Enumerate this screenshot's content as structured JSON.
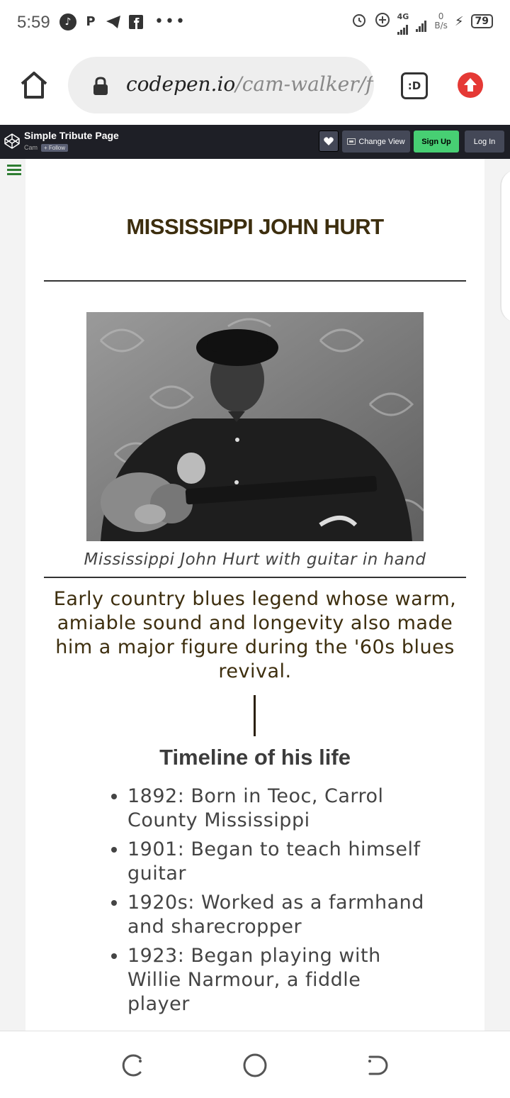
{
  "status_bar": {
    "time": "5:59",
    "network": "4G",
    "speed_value": "0",
    "speed_unit": "B/s",
    "battery": "79",
    "notification_icons": [
      "music-note-icon",
      "p-icon",
      "telegram-icon",
      "facebook-icon"
    ]
  },
  "browser": {
    "url_host": "codepen.io",
    "url_path": "/cam-walker/full",
    "tabs_label": ":D"
  },
  "codepen": {
    "title": "Simple Tribute Page",
    "author": "Cam",
    "follow_label": "+ Follow",
    "change_view_label": "Change View",
    "signup_label": "Sign Up",
    "login_label": "Log In",
    "accent_color": "#47cf73"
  },
  "page": {
    "title": "MISSISSIPPI JOHN HURT",
    "image_caption": "Mississippi John Hurt with guitar in hand",
    "tagline": "Early country blues legend whose warm, amiable sound and longevity also made him a major figure during the '60s blues revival.",
    "timeline_title": "Timeline of his life",
    "timeline": [
      "1892: Born in Teoc, Carrol County Mississippi",
      "1901: Began to teach himself guitar",
      "1920s: Worked as a farmhand and sharecropper",
      "1923: Began playing with Willie Narmour, a fiddle player"
    ],
    "title_color": "#3d2e0e"
  },
  "navigation": {
    "icons": [
      "back-icon",
      "home-circle-icon",
      "recents-icon"
    ]
  }
}
